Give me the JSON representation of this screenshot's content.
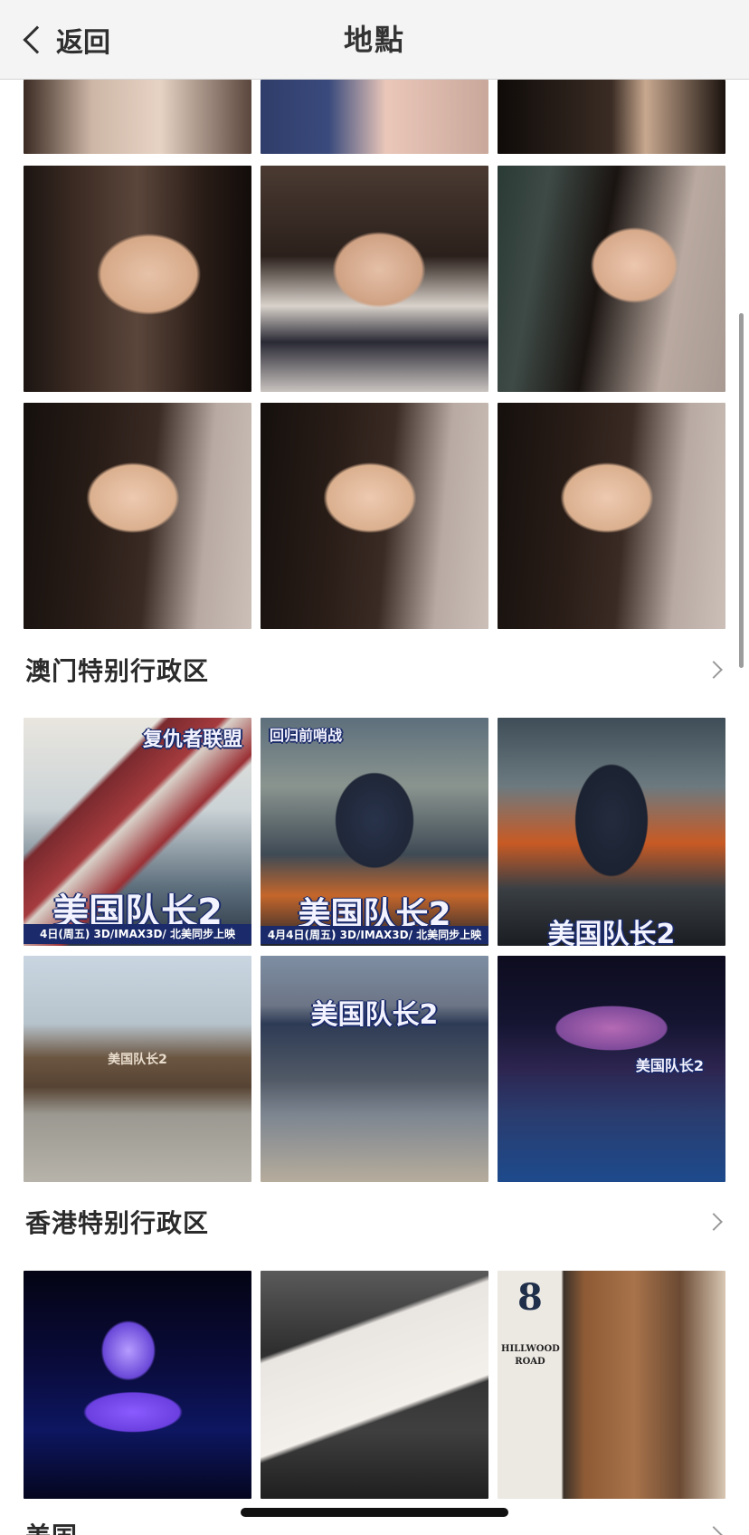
{
  "nav": {
    "back_label": "返回",
    "title": "地點"
  },
  "sections": [
    {
      "title": "澳门特别行政区"
    },
    {
      "title": "香港特别行政区"
    },
    {
      "title": "美国"
    }
  ],
  "posters": {
    "a_small": "复仇者联盟",
    "a_title": "美国队长2",
    "a_footer": "4日(周五) 3D/IMAX3D/ 北美同步上映",
    "b_top": "回归前哨战",
    "b_title": "美国队长2",
    "b_footer": "4月4日(周五) 3D/IMAX3D/ 北美同步上映",
    "c_title": "美国队长2"
  },
  "store": {
    "sign": "美国队长2",
    "mini": "美国队长2"
  },
  "shop": {
    "number": "8",
    "sign": "HILLWOOD ROAD"
  },
  "colors": {
    "nav_bg": "#f4f4f4",
    "text_primary": "#2b2b2b",
    "chevron": "#9a9a9a"
  }
}
